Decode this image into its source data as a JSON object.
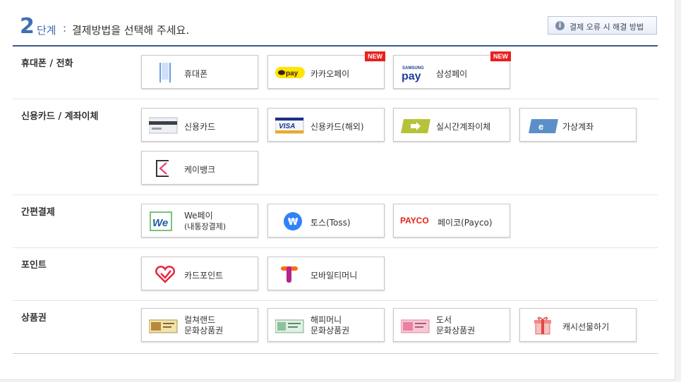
{
  "header": {
    "step_number": "2",
    "step_word": "단계",
    "step_colon": ":",
    "step_text": "결제방법을 선택해 주세요.",
    "help_button": "결제 오류 시 해결 방법",
    "help_icon": "info-icon"
  },
  "colors": {
    "accent": "#3e6fb0",
    "divider": "#3a5a8a",
    "new_badge": "#e8201c"
  },
  "rows": {
    "phone": {
      "title": "휴대폰 / 전화",
      "buttons": {
        "mobile": {
          "label": "휴대폰",
          "icon": "mobile-phone-icon"
        },
        "kakaopay": {
          "label": "카카오페이",
          "icon": "kakaopay-logo-icon",
          "icon_text": "pay",
          "badge": "NEW"
        },
        "samsungpay": {
          "label": "삼성페이",
          "icon": "samsung-pay-logo-icon",
          "icon_text_top": "SAMSUNG",
          "icon_text": "pay",
          "badge": "NEW"
        }
      }
    },
    "card": {
      "title": "신용카드 / 계좌이체",
      "buttons": {
        "credit": {
          "label": "신용카드",
          "icon": "credit-card-icon"
        },
        "overseas": {
          "label": "신용카드(해외)",
          "icon": "visa-card-icon",
          "icon_text": "VISA"
        },
        "transfer": {
          "label": "실시간계좌이체",
          "icon": "bank-transfer-icon"
        },
        "virtual": {
          "label": "가상계좌",
          "icon": "virtual-account-icon",
          "icon_text": "e"
        },
        "kbank": {
          "label": "케이뱅크",
          "icon": "kbank-logo-icon",
          "icon_text": "K"
        }
      }
    },
    "easy": {
      "title": "간편결제",
      "buttons": {
        "wepay": {
          "label": "We페이",
          "sub": "(내통장결제)",
          "icon": "wepay-logo-icon",
          "icon_text": "We"
        },
        "toss": {
          "label": "토스(Toss)",
          "icon": "toss-logo-icon",
          "icon_text": "₩"
        },
        "payco": {
          "label": "페이코(Payco)",
          "icon": "payco-logo-icon",
          "icon_text": "PAYCO"
        }
      }
    },
    "point": {
      "title": "포인트",
      "buttons": {
        "cardpoint": {
          "label": "카드포인트",
          "icon": "card-point-heart-icon"
        },
        "mobilemoney": {
          "label": "모바일티머니",
          "icon": "tmoney-logo-icon"
        }
      }
    },
    "voucher": {
      "title": "상품권",
      "buttons": {
        "cultureland": {
          "label1": "컬쳐랜드",
          "label2": "문화상품권",
          "icon": "cultureland-voucher-icon"
        },
        "happymoney": {
          "label1": "해피머니",
          "label2": "문화상품권",
          "icon": "happymoney-voucher-icon"
        },
        "book": {
          "label1": "도서",
          "label2": "문화상품권",
          "icon": "book-voucher-icon"
        },
        "gift": {
          "label": "캐시선물하기",
          "icon": "gift-box-icon"
        }
      }
    }
  }
}
